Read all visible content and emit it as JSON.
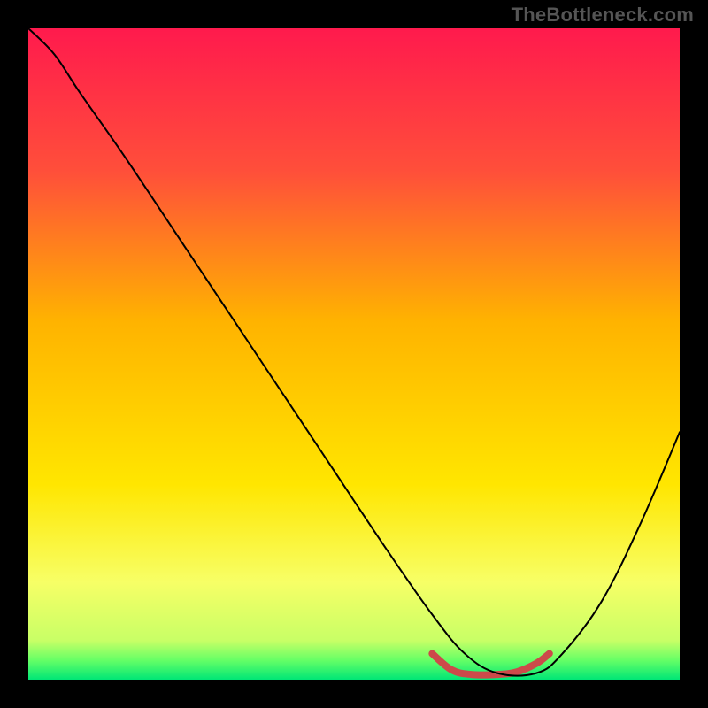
{
  "watermark": "TheBottleneck.com",
  "chart_data": {
    "type": "line",
    "title": "",
    "xlabel": "",
    "ylabel": "",
    "xlim": [
      0,
      100
    ],
    "ylim": [
      0,
      100
    ],
    "grid": false,
    "background": {
      "type": "vertical-gradient",
      "stops": [
        {
          "offset": 0.0,
          "color": "#ff1a4d"
        },
        {
          "offset": 0.22,
          "color": "#ff4f3a"
        },
        {
          "offset": 0.45,
          "color": "#ffb300"
        },
        {
          "offset": 0.7,
          "color": "#ffe600"
        },
        {
          "offset": 0.85,
          "color": "#f7ff66"
        },
        {
          "offset": 0.94,
          "color": "#c8ff66"
        },
        {
          "offset": 0.97,
          "color": "#66ff66"
        },
        {
          "offset": 1.0,
          "color": "#00e676"
        }
      ]
    },
    "series": [
      {
        "name": "bottleneck-curve",
        "color": "#000000",
        "width": 2,
        "x": [
          0,
          4,
          8,
          15,
          25,
          35,
          45,
          55,
          62,
          67,
          72,
          78,
          82,
          88,
          94,
          100
        ],
        "y": [
          100,
          96,
          90,
          80,
          65,
          50,
          35,
          20,
          10,
          4,
          1,
          1,
          4,
          12,
          24,
          38
        ]
      }
    ],
    "highlight": {
      "name": "optimal-range",
      "color": "#cc4a4a",
      "width": 8,
      "x": [
        62,
        65,
        68,
        72,
        75,
        78,
        80
      ],
      "y": [
        4,
        1.5,
        0.8,
        0.8,
        1.2,
        2.5,
        4
      ]
    }
  }
}
